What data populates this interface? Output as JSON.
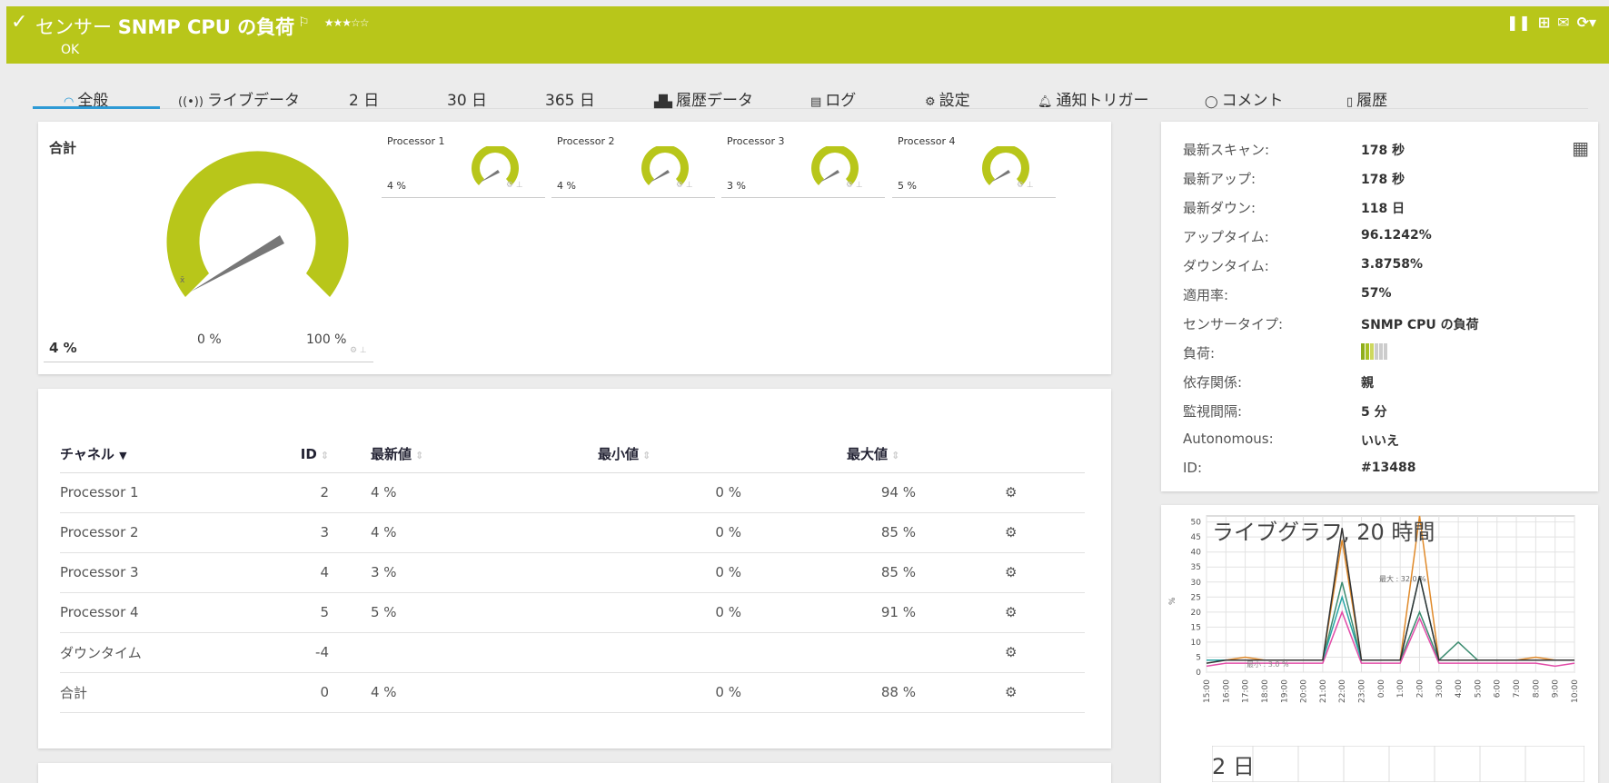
{
  "header": {
    "check_icon": "checkmark-icon",
    "title_prefix": "センサー",
    "title_bold": "SNMP CPU の負荷",
    "stars": "★★★☆☆",
    "status": "OK",
    "accent_color": "#b8c61a"
  },
  "tabs": [
    {
      "label": "全般",
      "icon": "gauge-icon"
    },
    {
      "label": "ライブデータ",
      "icon": "live-icon"
    },
    {
      "label": "2 日",
      "icon": ""
    },
    {
      "label": "30 日",
      "icon": ""
    },
    {
      "label": "365 日",
      "icon": ""
    },
    {
      "label": "履歴データ",
      "icon": "chart-area-icon"
    },
    {
      "label": "ログ",
      "icon": "log-icon"
    },
    {
      "label": "設定",
      "icon": "gear-icon"
    },
    {
      "label": "通知トリガー",
      "icon": "bell-icon"
    },
    {
      "label": "コメント",
      "icon": "comment-icon"
    },
    {
      "label": "履歴",
      "icon": "history-icon"
    }
  ],
  "gauges": {
    "total": {
      "label": "合計",
      "value": "4 %",
      "min_label": "0 %",
      "max_label": "100 %",
      "level": 0.04
    },
    "processors": [
      {
        "name": "Processor 1",
        "value": "4 %",
        "level": 0.04
      },
      {
        "name": "Processor 2",
        "value": "4 %",
        "level": 0.04
      },
      {
        "name": "Processor 3",
        "value": "3 %",
        "level": 0.03
      },
      {
        "name": "Processor 4",
        "value": "5 %",
        "level": 0.05
      }
    ]
  },
  "channels": {
    "headers": {
      "channel": "チャネル",
      "id": "ID",
      "last": "最新値",
      "min": "最小値",
      "max": "最大値"
    },
    "rows": [
      {
        "name": "Processor 1",
        "id": "2",
        "last": "4 %",
        "min": "0 %",
        "max": "94 %"
      },
      {
        "name": "Processor 2",
        "id": "3",
        "last": "4 %",
        "min": "0 %",
        "max": "85 %"
      },
      {
        "name": "Processor 3",
        "id": "4",
        "last": "3 %",
        "min": "0 %",
        "max": "85 %"
      },
      {
        "name": "Processor 4",
        "id": "5",
        "last": "5 %",
        "min": "0 %",
        "max": "91 %"
      },
      {
        "name": "ダウンタイム",
        "id": "-4",
        "last": "",
        "min": "",
        "max": ""
      },
      {
        "name": "合計",
        "id": "0",
        "last": "4 %",
        "min": "0 %",
        "max": "88 %"
      }
    ]
  },
  "info": [
    {
      "label": "最新スキャン:",
      "value": "178 秒"
    },
    {
      "label": "最新アップ:",
      "value": "178 秒"
    },
    {
      "label": "最新ダウン:",
      "value": "118 日"
    },
    {
      "label": "アップタイム:",
      "value": "96.1242%"
    },
    {
      "label": "ダウンタイム:",
      "value": "3.8758%"
    },
    {
      "label": "適用率:",
      "value": "57%"
    },
    {
      "label": "センサータイプ:",
      "value": "SNMP CPU の負荷"
    },
    {
      "label": "負荷:",
      "value": ""
    },
    {
      "label": "依存関係:",
      "value": "親"
    },
    {
      "label": "監視間隔:",
      "value": "5 分"
    },
    {
      "label": "Autonomous:",
      "value": "いいえ"
    },
    {
      "label": "ID:",
      "value": "#13488"
    }
  ],
  "load_level": 0.4,
  "live_graph": {
    "title": "ライブグラフ, 20 時間",
    "ylabel": "%",
    "y_ticks": [
      "0",
      "5",
      "10",
      "15",
      "20",
      "25",
      "30",
      "35",
      "40",
      "45",
      "50"
    ],
    "x_ticks": [
      "15:00",
      "16:00",
      "17:00",
      "18:00",
      "19:00",
      "20:00",
      "21:00",
      "22:00",
      "23:00",
      "0:00",
      "1:00",
      "2:00",
      "3:00",
      "4:00",
      "5:00",
      "6:00",
      "7:00",
      "8:00",
      "9:00",
      "10:00"
    ],
    "annotation_max": "最大 : 32.0 %",
    "annotation_min": "最小 : 3.0 %"
  },
  "graph2": {
    "title": "2 日"
  },
  "chart_data": {
    "type": "line",
    "title": "ライブグラフ, 20 時間",
    "xlabel": "",
    "ylabel": "%",
    "ylim": [
      0,
      52
    ],
    "x": [
      "15:00",
      "16:00",
      "17:00",
      "18:00",
      "19:00",
      "20:00",
      "21:00",
      "22:00",
      "23:00",
      "0:00",
      "1:00",
      "2:00",
      "3:00",
      "4:00",
      "5:00",
      "6:00",
      "7:00",
      "8:00",
      "9:00",
      "10:00"
    ],
    "series": [
      {
        "name": "Processor 1",
        "color": "#e08a2a",
        "values": [
          4,
          4,
          5,
          4,
          4,
          4,
          4,
          44,
          4,
          4,
          4,
          52,
          4,
          4,
          4,
          4,
          4,
          5,
          4,
          4
        ]
      },
      {
        "name": "Processor 2",
        "color": "#3c8c70",
        "values": [
          4,
          4,
          4,
          4,
          4,
          4,
          4,
          30,
          4,
          4,
          4,
          20,
          4,
          10,
          4,
          4,
          4,
          4,
          4,
          4
        ]
      },
      {
        "name": "Processor 3",
        "color": "#e24ca8",
        "values": [
          2,
          3,
          3,
          3,
          3,
          3,
          3,
          20,
          3,
          3,
          3,
          18,
          3,
          3,
          3,
          3,
          3,
          3,
          2,
          3
        ]
      },
      {
        "name": "Processor 4",
        "color": "#27a5a5",
        "values": [
          4,
          4,
          4,
          4,
          4,
          4,
          4,
          25,
          4,
          4,
          4,
          32,
          4,
          4,
          4,
          4,
          4,
          4,
          4,
          4
        ]
      },
      {
        "name": "合計",
        "color": "#333333",
        "values": [
          3,
          4,
          4,
          4,
          4,
          4,
          4,
          48,
          4,
          4,
          4,
          32,
          4,
          4,
          4,
          4,
          4,
          4,
          4,
          4
        ]
      }
    ]
  }
}
